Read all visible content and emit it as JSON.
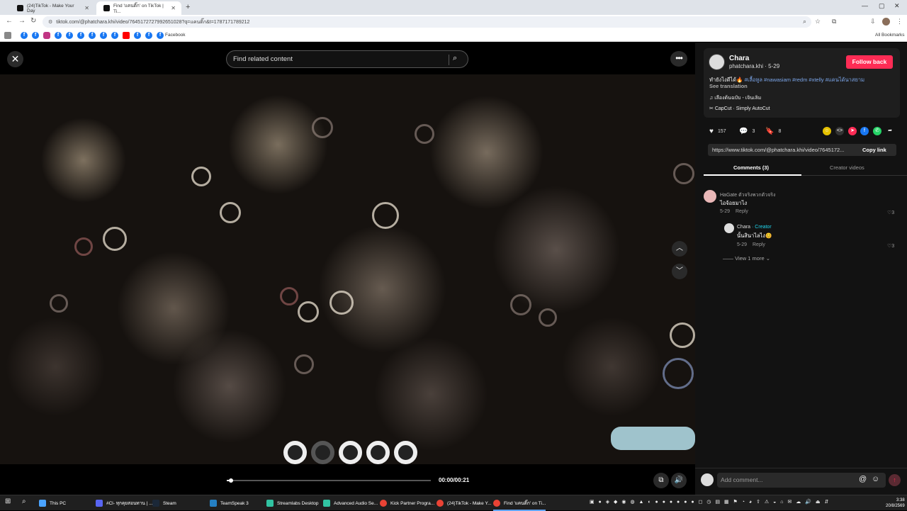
{
  "browser": {
    "tabs": [
      {
        "title": "(24)TikTok - Make Your Day",
        "active": false
      },
      {
        "title": "Find 'แคนติ๊ก' on TikTok | Ti...",
        "active": true
      }
    ],
    "url": "tiktok.com/@phatchara.khi/video/7645172727992651028?q=แคนติ๊ก&t=1787171789212",
    "bookmarks_label": "Facebook",
    "all_bookmarks": "All Bookmarks"
  },
  "player": {
    "search_placeholder": "Find related content",
    "time": "00:00/00:21",
    "progress": 0.02
  },
  "post": {
    "display_name": "Chara",
    "handle_date": "phatchara.khi · 5-29",
    "follow_label": "Follow back",
    "caption_text": "ทำยังไงดีได้🔥",
    "hashtags": "#เลื้อหูล #nawasiam #redm #xtelly #แคนได้นาสยาม",
    "see_translation": "See translation",
    "music": "เลืองต้นฉบับ - เจินเลิม",
    "capcut": "CapCut · Simply AutoCut",
    "likes": "157",
    "comments": "3",
    "saves": "8",
    "link": "https://www.tiktok.com/@phatchara.khi/video/7645172...",
    "copy_link": "Copy link"
  },
  "tabs": {
    "comments": "Comments (3)",
    "creator_videos": "Creator videos"
  },
  "comments": [
    {
      "name": "HaGate ตัวจริงพวกตัวจริง",
      "text": "ไอจ้อยมาไง",
      "date": "5-29",
      "reply": "Reply",
      "likes": "3"
    },
    {
      "name": "Chara",
      "creator": "· Creator",
      "text": "นั้นสินาไลไง😊",
      "date": "5-29",
      "reply": "Reply",
      "likes": "3"
    }
  ],
  "view_more": "View 1 more",
  "comment_input_placeholder": "Add comment...",
  "taskbar": {
    "items": [
      "This PC",
      "#Cl- ทุกคุยสอนทาน | ...",
      "Steam",
      "TeamSpeak 3",
      "Streamlabs Desktop",
      "Advanced Audio Se...",
      "Kick Partner Progra...",
      "(24)TikTok - Make Y...",
      "Find 'แคนติ๊ก' on Ti..."
    ],
    "time": "3:38",
    "date": "20/8/2569"
  }
}
